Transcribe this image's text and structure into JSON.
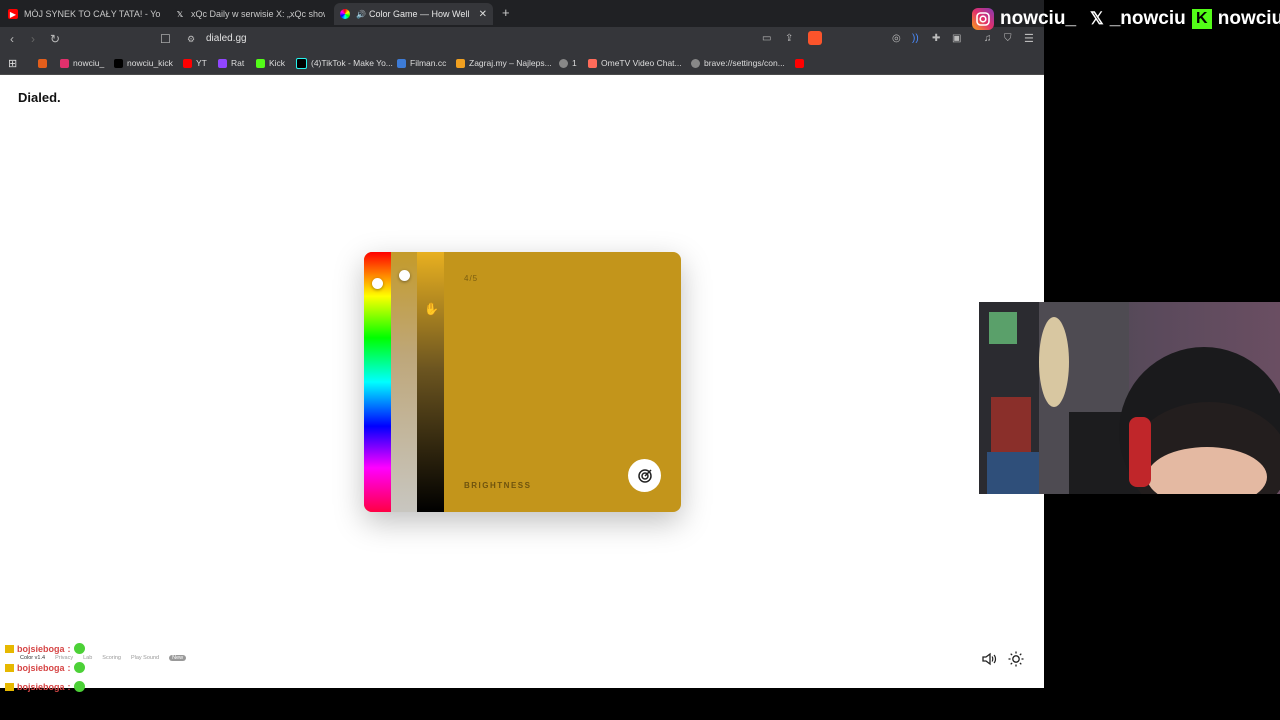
{
  "tabs": [
    {
      "title": "MÓJ SYNEK TO CAŁY TATA! - YouTube",
      "favicon": "youtube-icon",
      "color": "#ff0000"
    },
    {
      "title": "xQc Daily w serwisie X: „xQc shows of",
      "favicon": "x-icon",
      "color": "#000000"
    },
    {
      "title": "Color Game — How Well Can",
      "favicon": "colorwheel-icon",
      "color": "#d65cff",
      "active": true,
      "audio": true
    }
  ],
  "url": "dialed.gg",
  "bookmarks": [
    {
      "label": "",
      "icon": "apps-icon",
      "color": "#e35e1b"
    },
    {
      "label": "nowciu_",
      "icon": "instagram-icon",
      "color": "#e1306c"
    },
    {
      "label": "nowciu_kick",
      "icon": "x-icon",
      "color": "#000000"
    },
    {
      "label": "YT",
      "icon": "youtube-icon",
      "color": "#ff0000"
    },
    {
      "label": "Rat",
      "icon": "twitch-icon",
      "color": "#9146ff"
    },
    {
      "label": "Kick",
      "icon": "kick-icon",
      "color": "#53fc18"
    },
    {
      "label": "(4)TikTok - Make Yo...",
      "icon": "tiktok-icon",
      "color": "#000000"
    },
    {
      "label": "Filman.cc",
      "icon": "filman-icon",
      "color": "#3d7bd6"
    },
    {
      "label": "Zagraj.my – Najleps...",
      "icon": "zagraj-icon",
      "color": "#f0a020"
    },
    {
      "label": "1",
      "icon": "globe-icon",
      "color": "#888888"
    },
    {
      "label": "OmeTV Video Chat...",
      "icon": "ometv-icon",
      "color": "#ff6b5a"
    },
    {
      "label": "brave://settings/con...",
      "icon": "globe-icon",
      "color": "#888888"
    },
    {
      "label": "",
      "icon": "youtube-icon",
      "color": "#ff0000"
    }
  ],
  "page": {
    "logo": "Dialed.",
    "round": "4/5",
    "mode_label": "BRIGHTNESS",
    "target_color": "#c3951b",
    "hue_level": 0.12,
    "saturation_level": 0.09,
    "brightness_level": 0.22,
    "footer": {
      "version": "Color v1.4",
      "links": [
        "Privacy",
        "Lab",
        "Scoring",
        "Play Sound"
      ],
      "badge": "New"
    }
  },
  "overlay": {
    "social_handles": [
      "nowciu_",
      "_nowciu",
      "nowciu"
    ],
    "chat": [
      {
        "user": "bojsieboga",
        "sep": ":"
      },
      {
        "user": "bojsieboga",
        "sep": ":"
      },
      {
        "user": "bojsieboga",
        "sep": ":"
      }
    ]
  }
}
